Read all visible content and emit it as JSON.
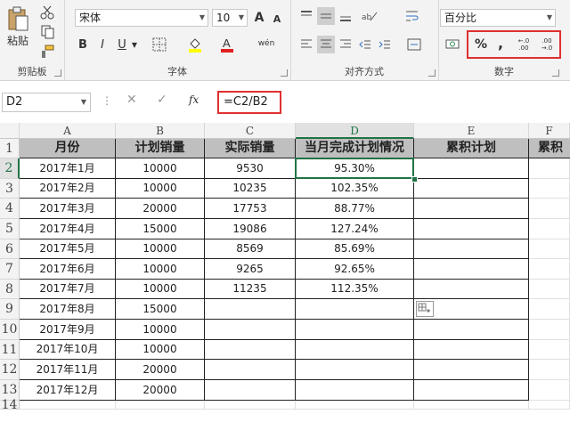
{
  "ribbon": {
    "clipboard": {
      "label": "剪贴板",
      "paste_label": "粘贴"
    },
    "font": {
      "label": "字体",
      "font_name": "宋体",
      "font_size": "10",
      "bold": "B",
      "italic": "I",
      "underline": "U",
      "wen": "wén",
      "grow": "A",
      "shrink": "A"
    },
    "alignment": {
      "label": "对齐方式"
    },
    "number": {
      "label": "数字",
      "format": "百分比",
      "percent": "%",
      "comma": ",",
      "inc_decimal": "←.0 .00",
      "dec_decimal": ".00 →.0"
    }
  },
  "formula_bar": {
    "name_box": "D2",
    "cancel": "✕",
    "enter": "✓",
    "fx": "fx",
    "formula": "=C2/B2"
  },
  "columns": [
    "A",
    "B",
    "C",
    "D",
    "E",
    "F"
  ],
  "rows": [
    "1",
    "2",
    "3",
    "4",
    "5",
    "6",
    "7",
    "8",
    "9",
    "10",
    "11",
    "12",
    "13",
    "14"
  ],
  "headers": [
    "月份",
    "计划销量",
    "实际销量",
    "当月完成计划情况",
    "累积计划",
    "累积"
  ],
  "table": [
    [
      "2017年1月",
      "10000",
      "9530",
      "95.30%"
    ],
    [
      "2017年2月",
      "10000",
      "10235",
      "102.35%"
    ],
    [
      "2017年3月",
      "20000",
      "17753",
      "88.77%"
    ],
    [
      "2017年4月",
      "15000",
      "19086",
      "127.24%"
    ],
    [
      "2017年5月",
      "10000",
      "8569",
      "85.69%"
    ],
    [
      "2017年6月",
      "10000",
      "9265",
      "92.65%"
    ],
    [
      "2017年7月",
      "10000",
      "11235",
      "112.35%"
    ],
    [
      "2017年8月",
      "15000",
      "",
      ""
    ],
    [
      "2017年9月",
      "10000",
      "",
      ""
    ],
    [
      "2017年10月",
      "10000",
      "",
      ""
    ],
    [
      "2017年11月",
      "20000",
      "",
      ""
    ],
    [
      "2017年12月",
      "20000",
      "",
      ""
    ]
  ],
  "selected_cell": "D2",
  "colors": {
    "accent": "#217346",
    "highlight": "#e03030",
    "header_fill": "#bfbfbf"
  }
}
